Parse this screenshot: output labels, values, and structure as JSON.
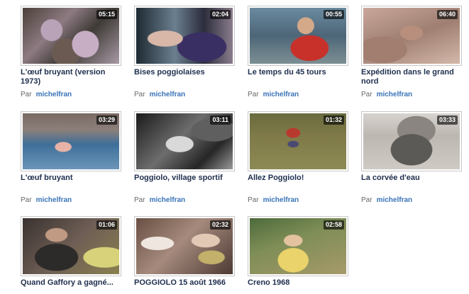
{
  "by_prefix": "Par",
  "videos": [
    {
      "title": "L'œuf bruyant (version 1973)",
      "duration": "05:15",
      "author": "michelfran"
    },
    {
      "title": "Bises poggiolaises",
      "duration": "02:04",
      "author": "michelfran"
    },
    {
      "title": "Le temps du 45 tours",
      "duration": "00:55",
      "author": "michelfran"
    },
    {
      "title": "Expédition dans le grand nord",
      "duration": "06:40",
      "author": "michelfran"
    },
    {
      "title": "L'œuf bruyant",
      "duration": "03:29",
      "author": "michelfran"
    },
    {
      "title": "Poggiolo, village sportif",
      "duration": "03:11",
      "author": "michelfran"
    },
    {
      "title": "Allez Poggiolo!",
      "duration": "01:32",
      "author": "michelfran"
    },
    {
      "title": "La corvée d'eau",
      "duration": "03:33",
      "author": "michelfran"
    },
    {
      "title": "Quand Gaffory a gagné...",
      "duration": "01:06",
      "author": ""
    },
    {
      "title": "POGGIOLO 15 août 1966",
      "duration": "02:32",
      "author": ""
    },
    {
      "title": "Creno 1968",
      "duration": "02:58",
      "author": ""
    }
  ]
}
